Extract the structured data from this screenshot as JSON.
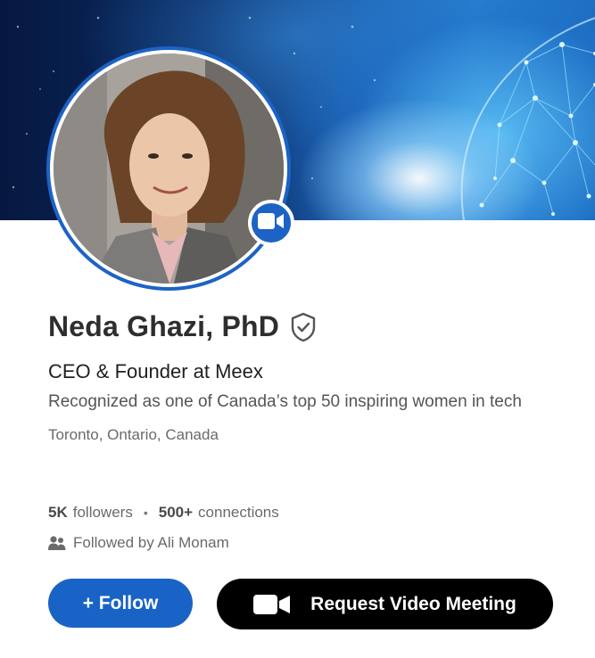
{
  "profile": {
    "name": "Neda Ghazi, PhD",
    "headline": "CEO & Founder at Meex",
    "summary": "Recognized as one of Canada’s top 50 inspiring women in tech",
    "location": "Toronto, Ontario, Canada",
    "verified_icon": "shield-check-icon",
    "video_badge_icon": "video-camera-icon"
  },
  "stats": {
    "followers_count": "5K",
    "followers_label": "followers",
    "separator": "•",
    "connections_count": "500+",
    "connections_label": "connections"
  },
  "followed_by": {
    "icon": "people-icon",
    "text": "Followed by Ali Monam"
  },
  "actions": {
    "follow_label": "+ Follow",
    "video_label": "Request Video Meeting",
    "video_icon": "video-camera-icon"
  },
  "colors": {
    "accent": "#1a63c6",
    "video_button": "#000000",
    "name_text": "#2e2e2e",
    "muted_text": "#6a6a6a"
  }
}
